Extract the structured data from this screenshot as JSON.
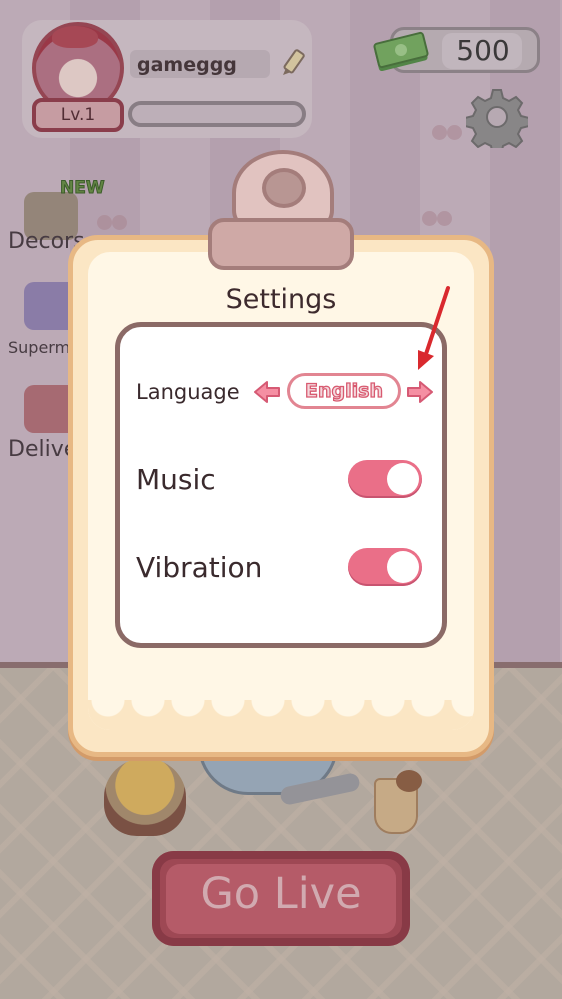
{
  "player": {
    "name": "gameggg",
    "level": "Lv.1"
  },
  "currency": {
    "cash": "500"
  },
  "side_menu": {
    "new_badge": "NEW",
    "items": [
      {
        "label": "Decors"
      },
      {
        "label": "Supermarket"
      },
      {
        "label": "Delivery"
      }
    ]
  },
  "settings": {
    "title": "Settings",
    "language_label": "Language",
    "language_value": "English",
    "music_label": "Music",
    "music_on": true,
    "vibration_label": "Vibration",
    "vibration_on": true
  },
  "footer": {
    "go_live_label": "Go Live"
  },
  "colors": {
    "toggle_on": "#ea6f88",
    "accent_red": "#d9292e",
    "modal_border": "#e7b884"
  }
}
